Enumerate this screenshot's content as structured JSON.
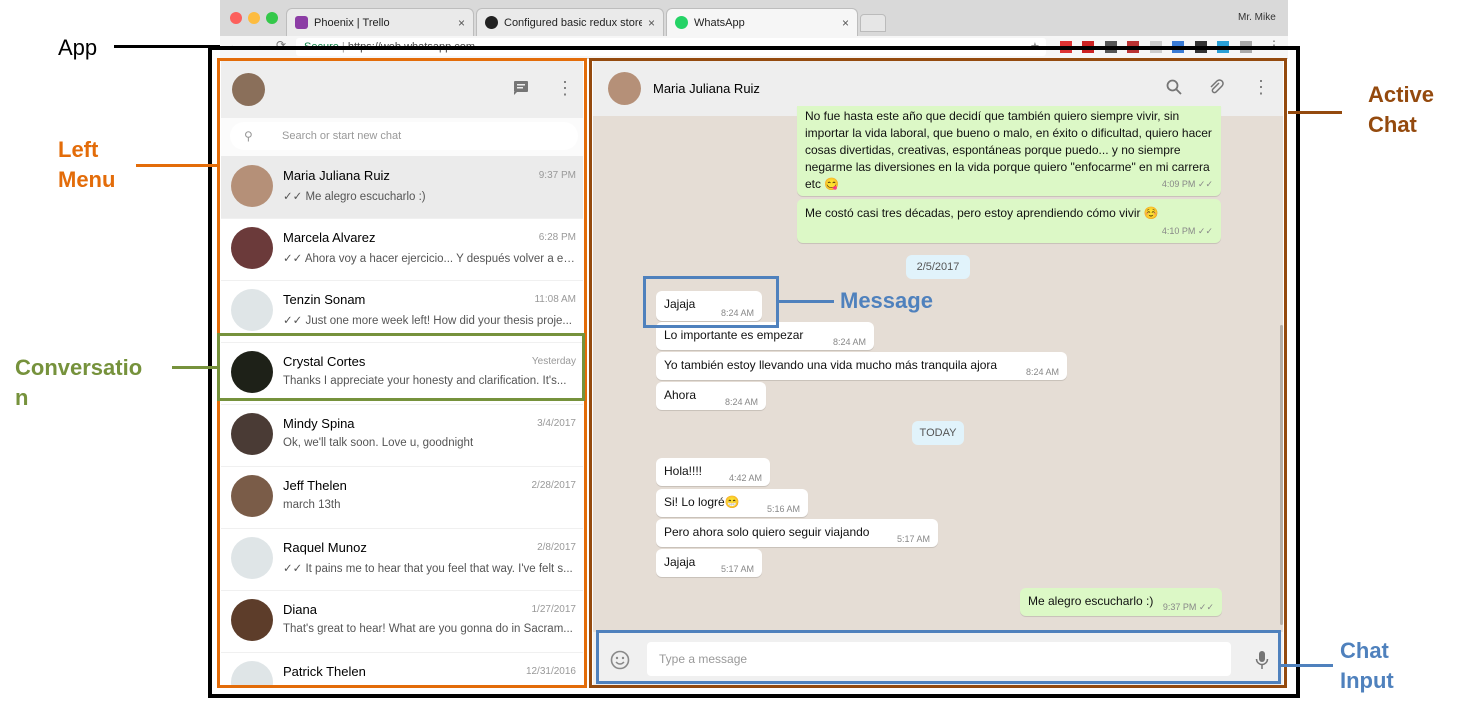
{
  "browser": {
    "tabs": [
      {
        "label": "Phoenix | Trello",
        "icon": "trello-icon"
      },
      {
        "label": "Configured basic redux store ·",
        "icon": "github-icon"
      },
      {
        "label": "WhatsApp",
        "icon": "whatsapp-icon"
      }
    ],
    "user": "Mr. Mike",
    "url_prefix": "Secure",
    "url": "https://web.whatsapp.com"
  },
  "left": {
    "search_placeholder": "Search or start new chat",
    "conversations": [
      {
        "name": "Maria Juliana Ruiz",
        "time": "9:37 PM",
        "message": "✓✓ Me alegro escucharlo :)"
      },
      {
        "name": "Marcela Alvarez",
        "time": "6:28 PM",
        "message": "✓✓ Ahora voy a hacer ejercicio... Y después volver a es..."
      },
      {
        "name": "Tenzin Sonam",
        "time": "11:08 AM",
        "message": "✓✓ Just one more week left! How did your thesis proje..."
      },
      {
        "name": "Crystal Cortes",
        "time": "Yesterday",
        "message": "Thanks I appreciate your honesty and clarification. It's..."
      },
      {
        "name": "Mindy Spina",
        "time": "3/4/2017",
        "message": "Ok, we'll talk soon. Love u, goodnight"
      },
      {
        "name": "Jeff Thelen",
        "time": "2/28/2017",
        "message": "march 13th"
      },
      {
        "name": "Raquel Munoz",
        "time": "2/8/2017",
        "message": "✓✓ It pains me to hear that you feel that way. I've felt s..."
      },
      {
        "name": "Diana",
        "time": "1/27/2017",
        "message": "That's great to hear! What are you gonna do in Sacram..."
      },
      {
        "name": "Patrick Thelen",
        "time": "12/31/2016",
        "message": ""
      }
    ]
  },
  "chat": {
    "contact_name": "Maria Juliana Ruiz",
    "messages_top": [
      {
        "text": "No fue hasta este año que decidí que también quiero siempre vivir, sin importar la vida laboral, que bueno o malo, en éxito o dificultad, quiero hacer cosas divertidas, creativas, espontáneas porque puedo... y no siempre negarme las diversiones en la vida porque quiero \"enfocarme\" en mi carrera etc 😋",
        "time": "4:09 PM ✓✓"
      },
      {
        "text": "Me costó casi tres décadas, pero estoy aprendiendo cómo vivir ☺️",
        "time": "4:10 PM ✓✓"
      }
    ],
    "date1": "2/5/2017",
    "messages_mid": [
      {
        "text": "Jajaja",
        "time": "8:24 AM"
      },
      {
        "text": "Lo importante es empezar",
        "time": "8:24 AM"
      },
      {
        "text": "Yo también estoy llevando una vida mucho más tranquila ajora",
        "time": "8:24 AM"
      },
      {
        "text": "Ahora",
        "time": "8:24 AM"
      }
    ],
    "date2": "TODAY",
    "messages_today": [
      {
        "text": "Hola!!!!",
        "time": "4:42 AM"
      },
      {
        "text": "Si! Lo logré😁",
        "time": "5:16 AM"
      },
      {
        "text": "Pero ahora solo quiero seguir viajando",
        "time": "5:17 AM"
      },
      {
        "text": "Jajaja",
        "time": "5:17 AM"
      },
      {
        "text": "Me alegro escucharlo :)",
        "time": "9:37 PM ✓✓"
      }
    ],
    "input_placeholder": "Type a message"
  },
  "annotations": {
    "app": "App",
    "left_menu": "Left Menu",
    "conversation": "Conversation",
    "active_chat": "Active Chat",
    "message": "Message",
    "chat_input": "Chat Input"
  },
  "colors": {
    "left_menu": "#e36c09",
    "conversation": "#76923c",
    "active_chat": "#944a0e",
    "blue": "#4f81bd"
  }
}
